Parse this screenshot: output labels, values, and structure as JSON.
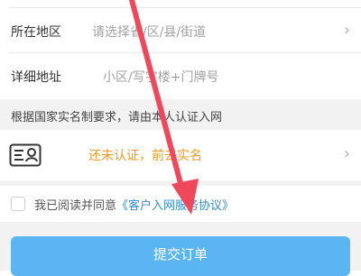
{
  "form": {
    "region": {
      "label": "所在地区",
      "placeholder": "请选择省/区/县/街道"
    },
    "address": {
      "label": "详细地址",
      "placeholder": "小区/写字楼+门牌号"
    }
  },
  "notice": {
    "text": "根据国家实名制要求，请由本人认证入网"
  },
  "verify": {
    "status_text": "还未认证，前去实名"
  },
  "agreement": {
    "prefix": "我已阅读并同意",
    "link": "《客户入网服务协议》"
  },
  "submit": {
    "label": "提交订单"
  },
  "colors": {
    "accent": "#5bb5f2",
    "link": "#2f8bd8",
    "warning": "#f39a1c",
    "annotation_arrow": "#f0475b"
  }
}
